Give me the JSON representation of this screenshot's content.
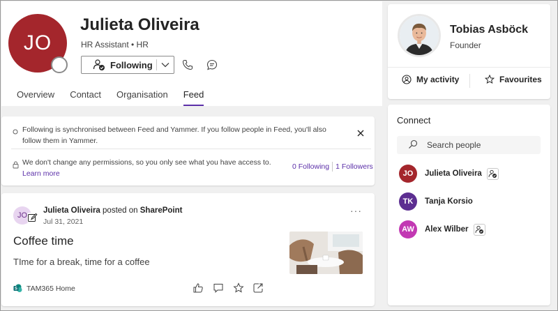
{
  "profile": {
    "initials": "JO",
    "name": "Julieta Oliveira",
    "title": "HR Assistant • HR",
    "follow_label": "Following",
    "colors": {
      "avatar": "#a4262c",
      "accent": "#5b2fa8"
    }
  },
  "tabs": [
    {
      "label": "Overview",
      "active": false
    },
    {
      "label": "Contact",
      "active": false
    },
    {
      "label": "Organisation",
      "active": false
    },
    {
      "label": "Feed",
      "active": true
    }
  ],
  "info_banner": {
    "sync_message": "Following is synchronised between Feed and Yammer. If you follow people in Feed, you'll also follow them in Yammer.",
    "permission_message": "We don't change any permissions, so you only see what you have access to.",
    "learn_more": "Learn more",
    "following_count": "0 Following",
    "followers_count": "1 Followers"
  },
  "post": {
    "author_initials": "JO",
    "author": "Julieta Oliveira",
    "posted_on": "posted on",
    "site": "SharePoint",
    "date": "Jul 31, 2021",
    "more": "···",
    "title": "Coffee time",
    "body": "TIme for a break, time for a coffee",
    "source": "TAM365 Home",
    "actions": [
      "like-icon",
      "comment-icon",
      "favourite-icon",
      "share-icon"
    ]
  },
  "me": {
    "name": "Tobias Asböck",
    "role": "Founder",
    "activity_label": "My activity",
    "favourites_label": "Favourites"
  },
  "connect": {
    "title": "Connect",
    "search_placeholder": "Search people",
    "people": [
      {
        "initials": "JO",
        "name": "Julieta Oliveira",
        "color": "#a4262c",
        "following": true
      },
      {
        "initials": "TK",
        "name": "Tanja Korsio",
        "color": "#5c2e91",
        "following": false
      },
      {
        "initials": "AW",
        "name": "Alex Wilber",
        "color": "#c239b3",
        "following": true
      }
    ]
  }
}
